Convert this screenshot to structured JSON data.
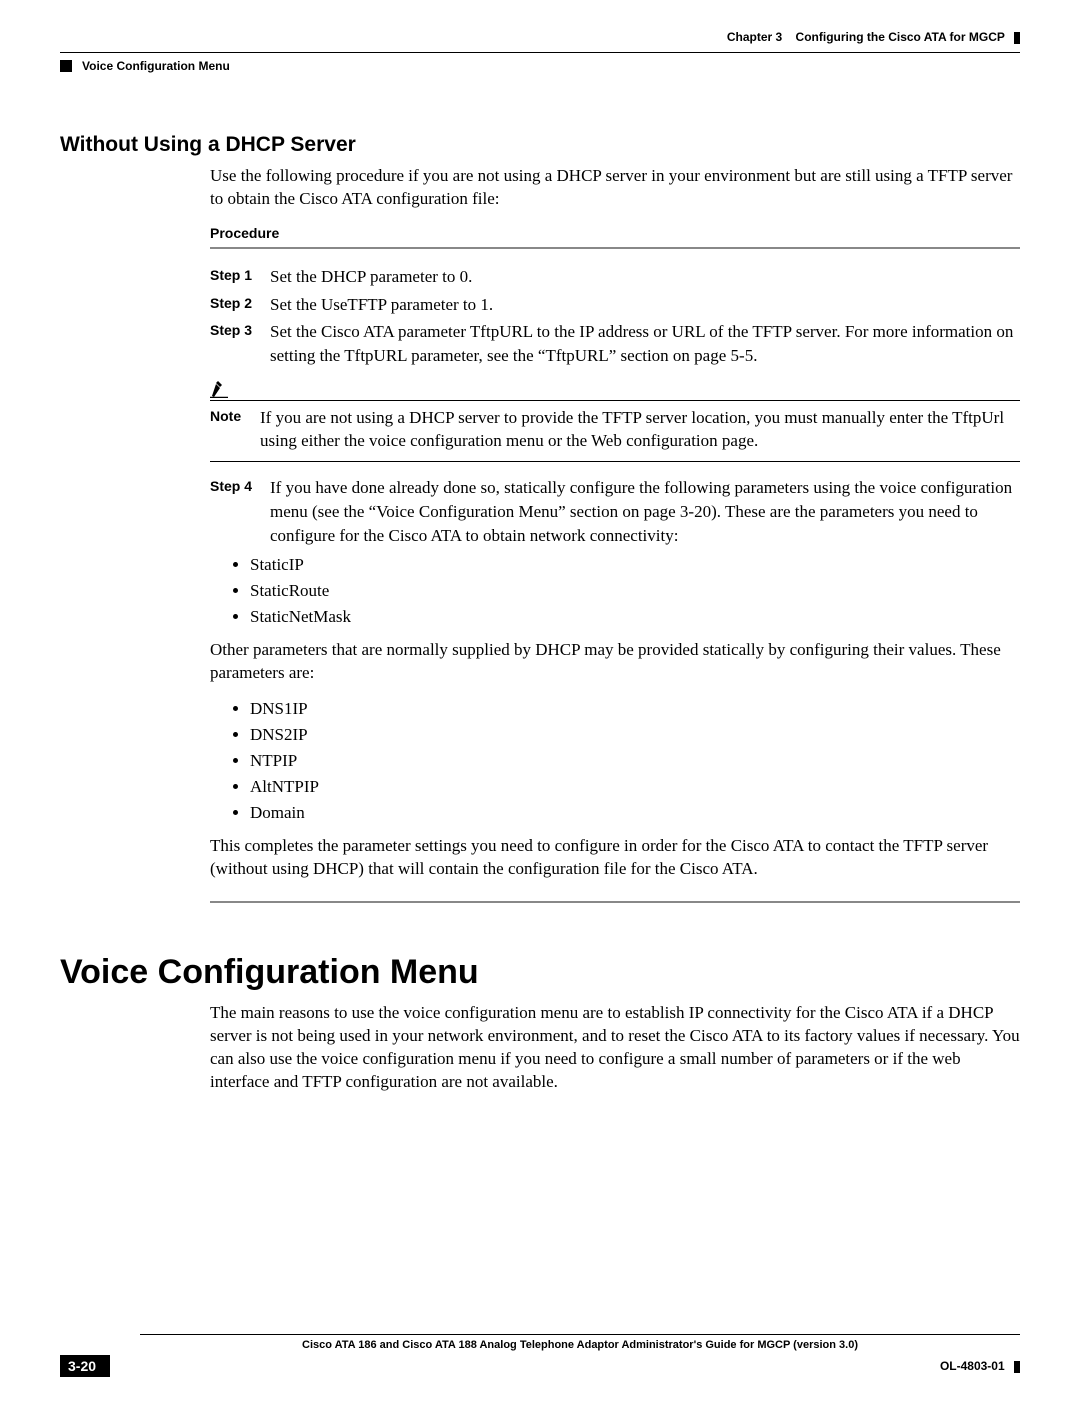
{
  "header": {
    "chapter_label": "Chapter 3",
    "chapter_title": "Configuring the Cisco ATA for MGCP",
    "section_crumb": "Voice Configuration Menu"
  },
  "section1": {
    "heading": "Without Using a DHCP Server",
    "intro": "Use the following procedure if you are not using a DHCP server in your environment but are still using a TFTP server to obtain the Cisco ATA configuration file:",
    "procedure_label": "Procedure",
    "steps": {
      "s1_label": "Step 1",
      "s1_text": "Set the DHCP parameter to 0.",
      "s2_label": "Step 2",
      "s2_text": "Set the UseTFTP parameter to 1.",
      "s3_label": "Step 3",
      "s3_text": "Set the Cisco ATA parameter TftpURL to the IP address or URL of the TFTP server. For more information on setting the TftpURL parameter, see the “TftpURL” section on page 5-5.",
      "s4_label": "Step 4",
      "s4_text": "If you have done already done so, statically configure the following parameters using the voice configuration menu (see the “Voice Configuration Menu” section on page 3-20). These are the parameters you need to configure for the Cisco ATA to obtain network connectivity:"
    },
    "note": {
      "label": "Note",
      "text": "If you are not using a DHCP server to provide the TFTP server location, you must manually enter the TftpUrl using either the voice configuration menu or the Web configuration page."
    },
    "list1": {
      "i1": "StaticIP",
      "i2": "StaticRoute",
      "i3": "StaticNetMask"
    },
    "mid_para": "Other parameters that are normally supplied by DHCP may be provided statically by configuring their values. These parameters are:",
    "list2": {
      "i1": "DNS1IP",
      "i2": "DNS2IP",
      "i3": "NTPIP",
      "i4": "AltNTPIP",
      "i5": "Domain"
    },
    "closing": "This completes the parameter settings you need to configure in order for the Cisco ATA to contact the TFTP server (without using DHCP) that will contain the configuration file for the Cisco ATA."
  },
  "section2": {
    "heading": "Voice Configuration Menu",
    "para": "The main reasons to use the voice configuration menu are to establish IP connectivity for the Cisco ATA if a DHCP server is not being used in your network environment, and to reset the Cisco ATA to its factory values if necessary. You can also use the voice configuration menu if you need to configure a small number of parameters or if the web interface and TFTP configuration are not available."
  },
  "footer": {
    "doc_title": "Cisco ATA 186 and Cisco ATA 188 Analog Telephone Adaptor Administrator's Guide for MGCP (version 3.0)",
    "page_num": "3-20",
    "doc_id": "OL-4803-01"
  }
}
